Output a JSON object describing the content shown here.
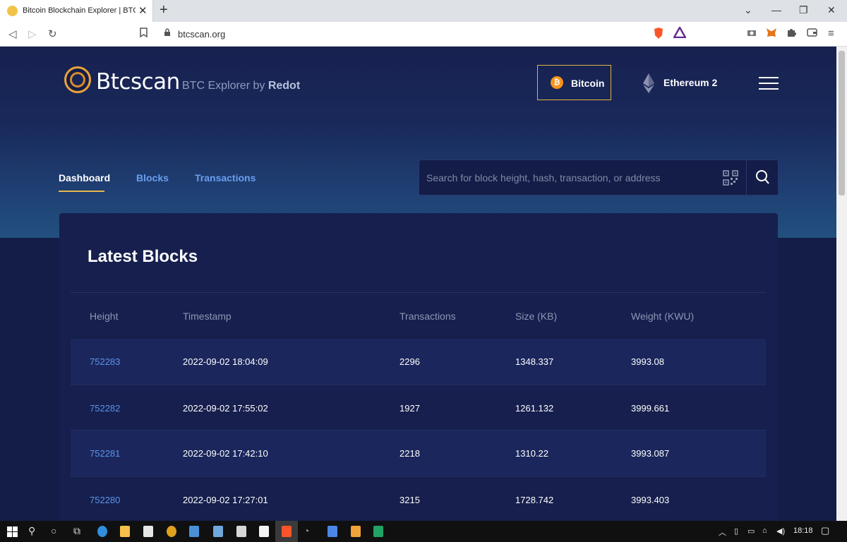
{
  "browser": {
    "tab_title": "Bitcoin Blockchain Explorer | BTCS",
    "tab_close": "✕",
    "new_tab": "+",
    "url": "btcscan.org",
    "win_controls": [
      "⌄",
      "—",
      "❐",
      "✕"
    ]
  },
  "site": {
    "logo_name": "Btcscan",
    "logo_tagline_prefix": "BTC Explorer by",
    "logo_tagline_brand": "Redot",
    "btc_symbol": "₿",
    "network_bitcoin": "Bitcoin",
    "network_ethereum": "Ethereum 2",
    "accent_color": "#e8b84a",
    "link_color": "#5b93e8"
  },
  "nav": {
    "tabs": [
      "Dashboard",
      "Blocks",
      "Transactions"
    ],
    "active": "Dashboard"
  },
  "search": {
    "placeholder": "Search for block height, hash, transaction, or address"
  },
  "latest_blocks": {
    "title": "Latest Blocks",
    "columns": [
      "Height",
      "Timestamp",
      "Transactions",
      "Size (KB)",
      "Weight (KWU)"
    ],
    "rows": [
      {
        "height": "752283",
        "timestamp": "2022-09-02 18:04:09",
        "transactions": "2296",
        "size": "1348.337",
        "weight": "3993.08"
      },
      {
        "height": "752282",
        "timestamp": "2022-09-02 17:55:02",
        "transactions": "1927",
        "size": "1261.132",
        "weight": "3999.661"
      },
      {
        "height": "752281",
        "timestamp": "2022-09-02 17:42:10",
        "transactions": "2218",
        "size": "1310.22",
        "weight": "3993.087"
      },
      {
        "height": "752280",
        "timestamp": "2022-09-02 17:27:01",
        "transactions": "3215",
        "size": "1728.742",
        "weight": "3993.403"
      }
    ]
  },
  "taskbar": {
    "clock": "18:18"
  }
}
